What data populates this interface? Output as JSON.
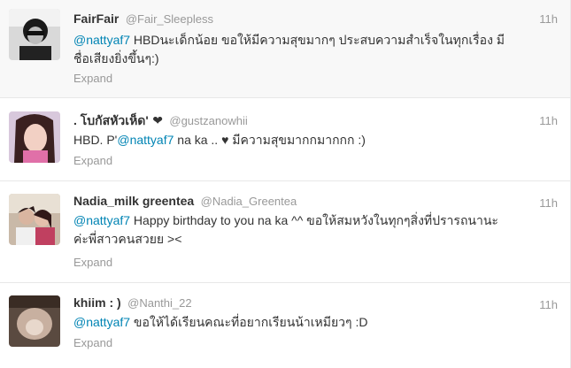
{
  "tweets": [
    {
      "fullname": "FairFair",
      "username": "@Fair_Sleepless",
      "time": "11h",
      "mention": "@nattyaf7",
      "text": " HBDนะเด็กน้อย ขอให้มีความสุขมากๆ ประสบความสำเร็จในทุกเรื่อง มี",
      "text2": "ชื่อเสียงยิ่งขึ้นๆ:)",
      "expand": "Expand"
    },
    {
      "fullname": ". โบกัสหัวเห็ด'",
      "heart": "❤",
      "username": "@gustzanowhii",
      "time": "11h",
      "prefix": "HBD. P'",
      "mention": "@nattyaf7",
      "text": " na ka .. ♥ มีความสุขมากกมากกก :)",
      "expand": "Expand"
    },
    {
      "fullname": "Nadia_milk greentea",
      "username": "@Nadia_Greentea",
      "time": "11h",
      "mention": "@nattyaf7",
      "text": " Happy birthday to you na ka ^^ ขอให้สมหวังในทุกๆสิ่งที่ปรารถนานะ",
      "text2": "ค่ะพี่สาวคนสวยย ><",
      "expand": "Expand"
    },
    {
      "fullname": "khiim : )",
      "username": "@Nanthi_22",
      "time": "11h",
      "mention": "@nattyaf7",
      "text": " ขอให้ได้เรียนคณะที่อยากเรียนน้าเหมียวๆ :D",
      "expand": "Expand"
    }
  ]
}
